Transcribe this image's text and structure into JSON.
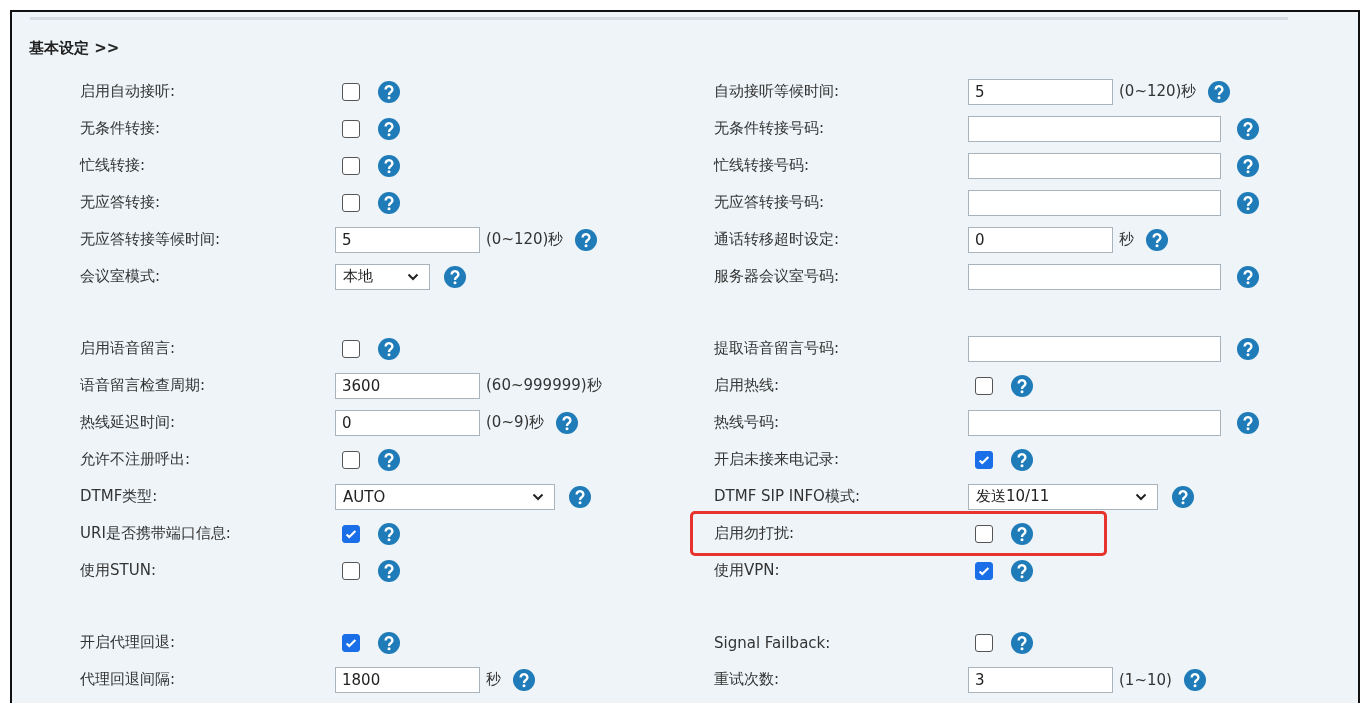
{
  "section_title": "基本设定 >>",
  "groups": [
    {
      "rows": [
        {
          "left": {
            "label": "启用自动接听:",
            "kind": "checkbox",
            "checked": false,
            "help": true
          },
          "right": {
            "label": "自动接听等候时间:",
            "kind": "short-field",
            "value": "5",
            "unit": "(0~120)秒",
            "help": true
          }
        },
        {
          "left": {
            "label": "无条件转接:",
            "kind": "checkbox",
            "checked": false,
            "help": true
          },
          "right": {
            "label": "无条件转接号码:",
            "kind": "field",
            "help": true
          }
        },
        {
          "left": {
            "label": "忙线转接:",
            "kind": "checkbox",
            "checked": false,
            "help": true
          },
          "right": {
            "label": "忙线转接号码:",
            "kind": "field",
            "help": true
          }
        },
        {
          "left": {
            "label": "无应答转接:",
            "kind": "checkbox",
            "checked": false,
            "help": true
          },
          "right": {
            "label": "无应答转接号码:",
            "kind": "field",
            "help": true
          }
        },
        {
          "left": {
            "label": "无应答转接等候时间:",
            "kind": "short-field",
            "value": "5",
            "unit": "(0~120)秒",
            "help": true
          },
          "right": {
            "label": "通话转移超时设定:",
            "kind": "short-field",
            "value": "0",
            "unit": "秒",
            "help": true
          }
        },
        {
          "left": {
            "label": "会议室模式:",
            "kind": "short-select",
            "value": "本地",
            "help": true
          },
          "right": {
            "label": "服务器会议室号码:",
            "kind": "field",
            "help": true
          }
        }
      ]
    },
    {
      "rows": [
        {
          "left": {
            "label": "启用语音留言:",
            "kind": "checkbox",
            "checked": false,
            "help": true
          },
          "right": {
            "label": "提取语音留言号码:",
            "kind": "field",
            "help": true
          }
        },
        {
          "left": {
            "label": "语音留言检查周期:",
            "kind": "short-field",
            "value": "3600",
            "unit": "(60~999999)秒",
            "help": false
          },
          "right": {
            "label": "启用热线:",
            "kind": "checkbox",
            "checked": false,
            "help": true
          }
        },
        {
          "left": {
            "label": "热线延迟时间:",
            "kind": "short-field",
            "value": "0",
            "unit": "(0~9)秒",
            "help": true
          },
          "right": {
            "label": "热线号码:",
            "kind": "field",
            "help": true
          }
        },
        {
          "left": {
            "label": "允许不注册呼出:",
            "kind": "checkbox",
            "checked": false,
            "help": true
          },
          "right": {
            "label": "开启未接来电记录:",
            "kind": "checkbox",
            "checked": true,
            "help": true
          }
        },
        {
          "left": {
            "label": "DTMF类型:",
            "kind": "wide-select",
            "value": "AUTO",
            "help": true
          },
          "right": {
            "label": "DTMF SIP INFO模式:",
            "kind": "select",
            "value": "发送10/11",
            "help": true
          }
        },
        {
          "left": {
            "label": "URI是否携带端口信息:",
            "kind": "checkbox",
            "checked": true,
            "help": true
          },
          "right": {
            "label": "启用勿打扰:",
            "kind": "checkbox",
            "checked": false,
            "help": true,
            "highlighted": true
          }
        },
        {
          "left": {
            "label": "使用STUN:",
            "kind": "checkbox",
            "checked": false,
            "help": true
          },
          "right": {
            "label": "使用VPN:",
            "kind": "checkbox",
            "checked": true,
            "help": true
          }
        }
      ]
    },
    {
      "rows": [
        {
          "left": {
            "label": "开启代理回退:",
            "kind": "checkbox",
            "checked": true,
            "help": true
          },
          "right": {
            "label": "Signal Failback:",
            "kind": "checkbox",
            "checked": false,
            "help": true
          }
        },
        {
          "left": {
            "label": "代理回退间隔:",
            "kind": "short-field",
            "value": "1800",
            "unit": "秒",
            "help": true
          },
          "right": {
            "label": "重试次数:",
            "kind": "short-field",
            "value": "3",
            "unit": "(1~10)",
            "help": true
          }
        }
      ]
    }
  ]
}
